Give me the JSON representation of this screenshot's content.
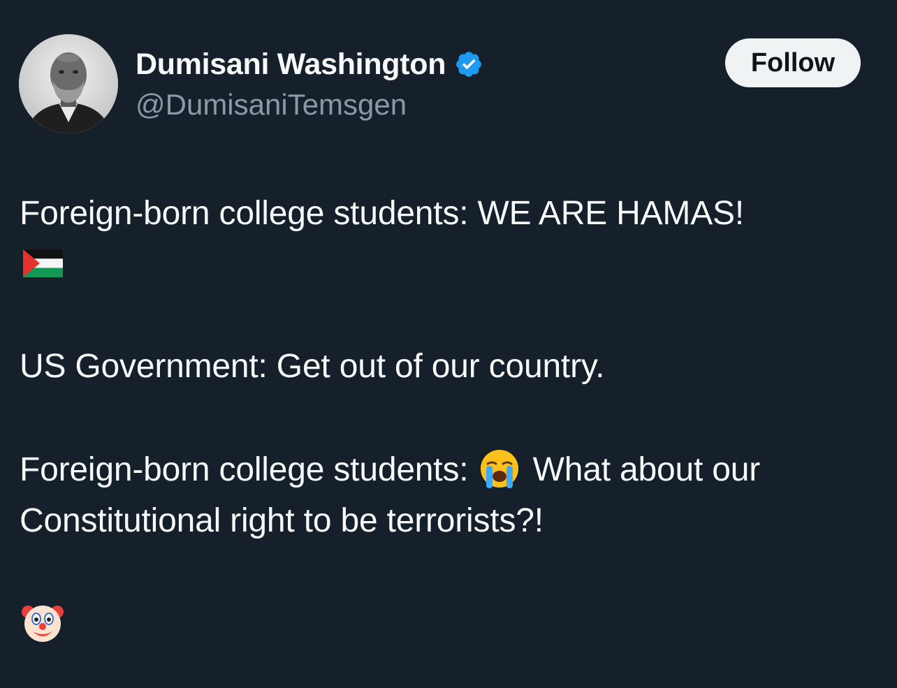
{
  "author": {
    "display_name": "Dumisani Washington",
    "handle": "@DumisaniTemsgen",
    "verified": true,
    "avatar_icon": "profile-photo",
    "verified_icon": "verified-badge-icon"
  },
  "actions": {
    "follow_label": "Follow"
  },
  "post": {
    "line1": "Foreign-born college students: WE ARE HAMAS!",
    "line1_emoji": "palestine-flag-icon",
    "line2": "US Government: Get out of our country.",
    "line3_prefix": "Foreign-born college students:",
    "line3_emoji": "loudly-crying-face-icon",
    "line3_suffix": "What about our",
    "line4": "Constitutional right to be terrorists?!",
    "line5_emoji": "clown-face-icon"
  },
  "colors": {
    "background": "#15202b",
    "text_primary": "#f7f9f9",
    "text_secondary": "#8b98a5",
    "verified_blue": "#1d9bf0",
    "follow_bg": "#eff3f4",
    "follow_text": "#0f1419"
  }
}
